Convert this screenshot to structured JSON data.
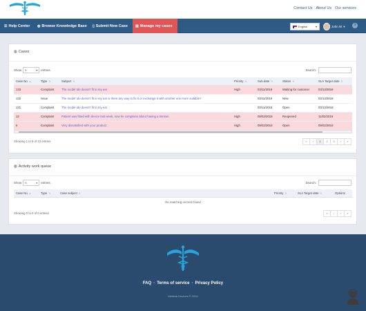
{
  "header": {
    "links": [
      "Contact Us",
      "About Us",
      "Our services"
    ]
  },
  "nav": {
    "items": [
      {
        "label": "Help Center",
        "icon": "list-icon"
      },
      {
        "label": "Browse Knowledge Base",
        "icon": "globe-icon"
      },
      {
        "label": "Submit New Case",
        "icon": "document-icon"
      },
      {
        "label": "Manage my cases",
        "icon": "briefcase-icon",
        "active": true
      }
    ],
    "language": "English",
    "user": "John W"
  },
  "cases": {
    "title": "Cases",
    "show_label": "Show",
    "entries_value": "5",
    "entries_label": "entries",
    "search_label": "Search:",
    "columns": [
      "Case No",
      "Type",
      "Subject",
      "Priority",
      "Sub.date",
      "Status",
      "SLA Target date"
    ],
    "rows": [
      {
        "no": "133",
        "type": "Complaint",
        "subject": "The model Ido doesn't fit to my ear",
        "priority": "High",
        "date": "03/11/2019",
        "status": "Waiting for customer",
        "sla": "03/13/2019",
        "highlight": true
      },
      {
        "no": "132",
        "type": "Issue",
        "subject": "The model Ido doesn't fit to my ear is there any way to fix it or exchange it with another one more suitable?",
        "priority": "",
        "date": "03/11/2019",
        "status": "New",
        "sla": "03/13/2019",
        "highlight": false
      },
      {
        "no": "131",
        "type": "Complaint",
        "subject": "The model Ido doesn't fit to my ear",
        "priority": "",
        "date": "03/11/2019",
        "status": "Open",
        "sla": "03/13/2019",
        "highlight": false
      },
      {
        "no": "12",
        "type": "Complaint",
        "subject": "Patient was fitted with device last week, now he complains about having a tinnitus",
        "priority": "High",
        "date": "09/02/2019",
        "status": "Reopened",
        "sla": "11/02/2019",
        "highlight": true
      },
      {
        "no": "6",
        "type": "Complaint",
        "subject": "Very dissatisfied with your product",
        "priority": "High",
        "date": "09/02/2019",
        "status": "Open",
        "sla": "09/02/2019",
        "highlight": true
      }
    ],
    "info": "Showing 1 to 5 of 13 entries",
    "pager": [
      "«",
      "‹",
      "1",
      "2",
      "3",
      "›",
      "»"
    ]
  },
  "activity": {
    "title": "Activity work queue",
    "show_label": "Show",
    "entries_value": "5",
    "entries_label": "entries",
    "search_label": "Search:",
    "columns": [
      "Case No",
      "Type",
      "Case subject",
      "Priority",
      "SLA Target date",
      "Options"
    ],
    "empty": "No matching records found",
    "info": "Showing 0 to 0 of 0 entries",
    "pager": [
      "«",
      "‹",
      "›",
      "»"
    ]
  },
  "footer": {
    "links": [
      "FAQ",
      "Terms of service",
      "Privacy Policy"
    ],
    "separator": "·",
    "copyright": "Medical Devices © 2016"
  },
  "colors": {
    "brand": "#2e5a86",
    "active_tab": "#e05555",
    "highlight_row": "#fadadd",
    "footer": "#2a4b6d",
    "logo": "#29a3dc"
  }
}
